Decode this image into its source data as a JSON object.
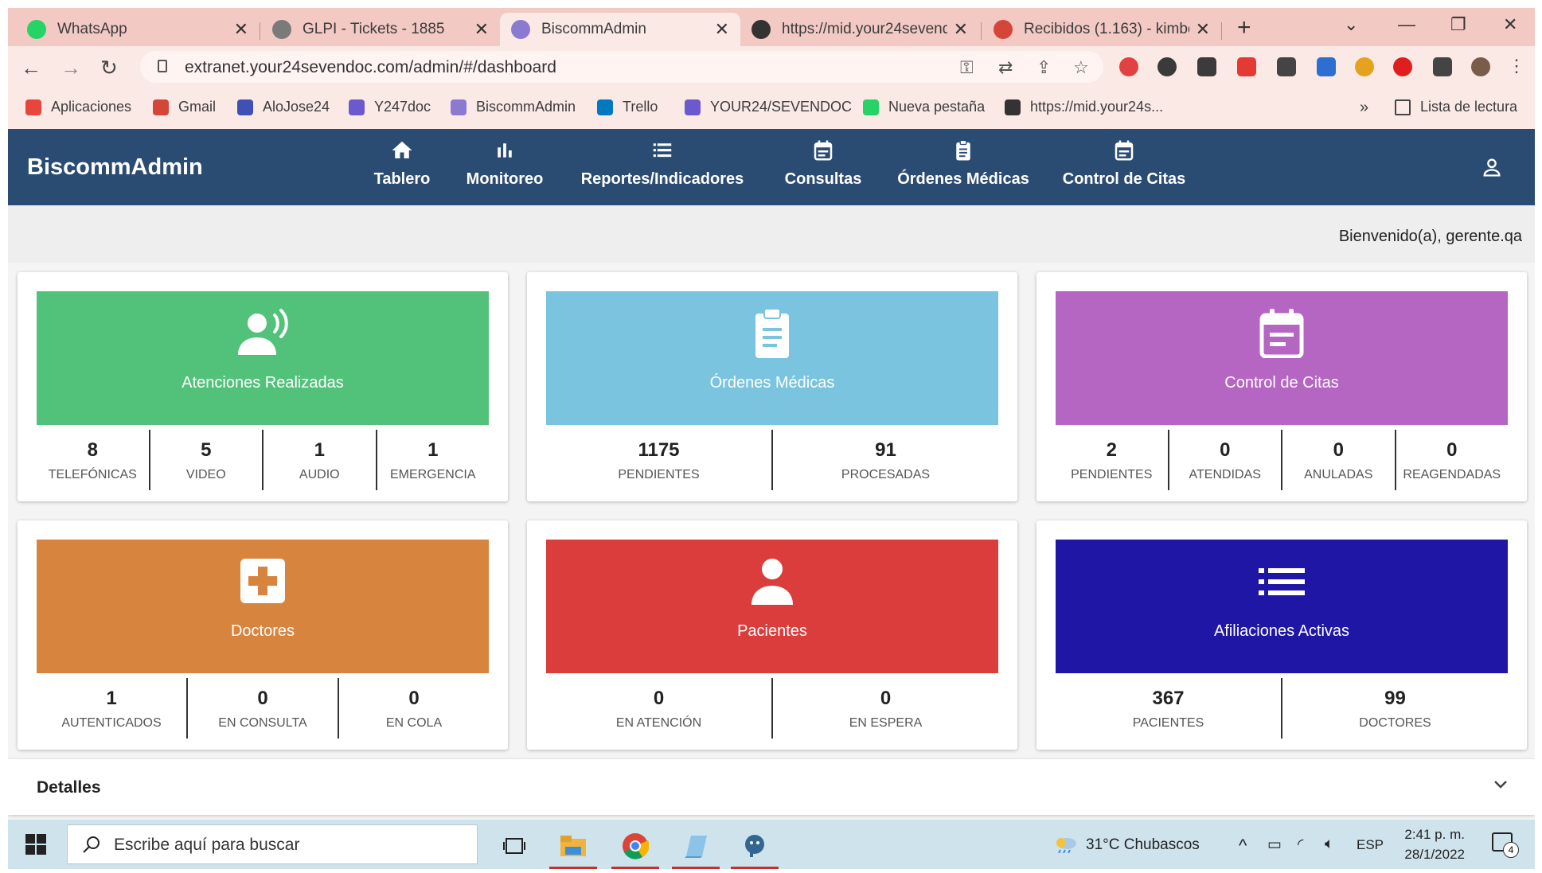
{
  "browser": {
    "tabs": [
      {
        "title": "WhatsApp",
        "color": "#25d366"
      },
      {
        "title": "GLPI - Tickets - 1885",
        "color": "#7a7a7a"
      },
      {
        "title": "BiscommAdmin",
        "color": "#8a7bd0"
      },
      {
        "title": "https://mid.your24sevend",
        "color": "#333333"
      },
      {
        "title": "Recibidos (1.163) - kimbe",
        "color": "#d44638"
      }
    ],
    "url": "extranet.your24sevendoc.com/admin/#/dashboard",
    "bookmarks": [
      {
        "label": "Aplicaciones",
        "color": "#e8453c"
      },
      {
        "label": "Gmail",
        "color": "#d44638"
      },
      {
        "label": "AloJose24",
        "color": "#3f51b5"
      },
      {
        "label": "Y247doc",
        "color": "#6a5acd"
      },
      {
        "label": "BiscommAdmin",
        "color": "#8a7bd0"
      },
      {
        "label": "Trello",
        "color": "#0079bf"
      },
      {
        "label": "YOUR24/SEVENDOC",
        "color": "#6a5acd"
      },
      {
        "label": "Nueva pestaña",
        "color": "#25d366"
      },
      {
        "label": "https://mid.your24s...",
        "color": "#333333"
      }
    ],
    "more_bookmarks": "»",
    "reading_list": "Lista de lectura"
  },
  "app": {
    "brand": "BiscommAdmin",
    "nav": [
      {
        "label": "Tablero",
        "icon": "home-icon"
      },
      {
        "label": "Monitoreo",
        "icon": "bar-chart-icon"
      },
      {
        "label": "Reportes/Indicadores",
        "icon": "list-icon"
      },
      {
        "label": "Consultas",
        "icon": "calendar-icon"
      },
      {
        "label": "Órdenes Médicas",
        "icon": "clipboard-icon"
      },
      {
        "label": "Control de Citas",
        "icon": "calendar-icon"
      }
    ],
    "welcome": "Bienvenido(a), gerente.qa"
  },
  "cards": [
    {
      "title": "Atenciones Realizadas",
      "color": "#52c27a",
      "icon": "voice-icon",
      "stats": [
        {
          "value": "8",
          "label": "Telefónicas"
        },
        {
          "value": "5",
          "label": "Video"
        },
        {
          "value": "1",
          "label": "Audio"
        },
        {
          "value": "1",
          "label": "Emergencia"
        }
      ]
    },
    {
      "title": "Órdenes Médicas",
      "color": "#7ac4df",
      "icon": "clipboard-icon",
      "stats": [
        {
          "value": "1175",
          "label": "Pendientes"
        },
        {
          "value": "91",
          "label": "Procesadas"
        }
      ]
    },
    {
      "title": "Control de Citas",
      "color": "#b565c2",
      "icon": "calendar-icon",
      "stats": [
        {
          "value": "2",
          "label": "Pendientes"
        },
        {
          "value": "0",
          "label": "Atendidas"
        },
        {
          "value": "0",
          "label": "Anuladas"
        },
        {
          "value": "0",
          "label": "Reagendadas"
        }
      ]
    },
    {
      "title": "Doctores",
      "color": "#d7843e",
      "icon": "medical-cross-icon",
      "stats": [
        {
          "value": "1",
          "label": "Autenticados"
        },
        {
          "value": "0",
          "label": "En consulta"
        },
        {
          "value": "0",
          "label": "En cola"
        }
      ]
    },
    {
      "title": "Pacientes",
      "color": "#db3c3c",
      "icon": "person-icon",
      "stats": [
        {
          "value": "0",
          "label": "En atención"
        },
        {
          "value": "0",
          "label": "En espera"
        }
      ]
    },
    {
      "title": "Afiliaciones Activas",
      "color": "#2016a6",
      "icon": "list-icon",
      "stats": [
        {
          "value": "367",
          "label": "Pacientes"
        },
        {
          "value": "99",
          "label": "Doctores"
        }
      ]
    }
  ],
  "details": {
    "title": "Detalles"
  },
  "taskbar": {
    "search_placeholder": "Escribe aquí para buscar",
    "weather": "31°C  Chubascos",
    "language": "ESP",
    "time": "2:41 p. m.",
    "date": "28/1/2022",
    "notifications": "4"
  }
}
